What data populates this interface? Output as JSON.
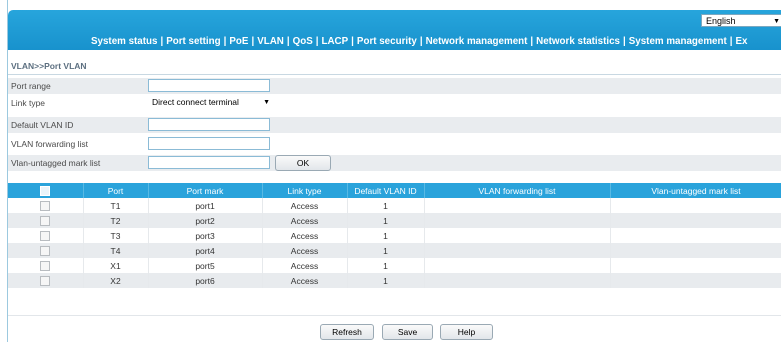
{
  "language": {
    "selected": "English"
  },
  "nav": {
    "items": [
      "System status",
      "Port setting",
      "PoE",
      "VLAN",
      "QoS",
      "LACP",
      "Port security",
      "Network management",
      "Network statistics",
      "System management",
      "Ex"
    ]
  },
  "breadcrumb": "VLAN>>Port VLAN",
  "form": {
    "port_range": "Port range",
    "link_type": "Link type",
    "link_type_value": "Direct connect terminal",
    "default_vlan_id": "Default VLAN ID",
    "vlan_forwarding_list": "VLAN forwarding list",
    "vlan_untagged_mark_list": "Vlan-untagged mark list",
    "ok_label": "OK"
  },
  "table": {
    "columns": [
      "Port",
      "Port mark",
      "Link type",
      "Default VLAN ID",
      "VLAN forwarding list",
      "Vlan-untagged mark list"
    ],
    "rows": [
      {
        "port": "T1",
        "mark": "port1",
        "link": "Access",
        "vlan": "1"
      },
      {
        "port": "T2",
        "mark": "port2",
        "link": "Access",
        "vlan": "1"
      },
      {
        "port": "T3",
        "mark": "port3",
        "link": "Access",
        "vlan": "1"
      },
      {
        "port": "T4",
        "mark": "port4",
        "link": "Access",
        "vlan": "1"
      },
      {
        "port": "X1",
        "mark": "port5",
        "link": "Access",
        "vlan": "1"
      },
      {
        "port": "X2",
        "mark": "port6",
        "link": "Access",
        "vlan": "1"
      }
    ]
  },
  "buttons": {
    "refresh": "Refresh",
    "save": "Save",
    "help": "Help"
  }
}
